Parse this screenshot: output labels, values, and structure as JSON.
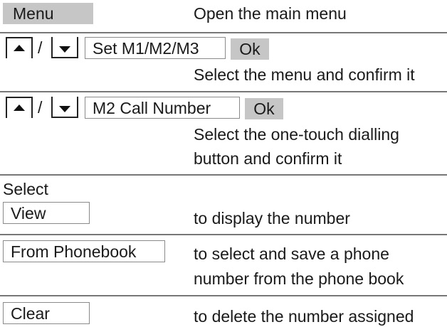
{
  "rows": [
    {
      "key": "Menu",
      "description": "Open the main menu"
    },
    {
      "slash": "/",
      "box": "Set M1/M2/M3",
      "ok": "Ok",
      "description": "Select the menu and confirm it"
    },
    {
      "slash": "/",
      "box": "M2 Call Number",
      "ok": "Ok",
      "description_line1": "Select the one-touch dialling",
      "description_line2": "button and confirm it"
    }
  ],
  "select_heading": "Select",
  "options": [
    {
      "key": "View",
      "description": "to display the number"
    },
    {
      "key": "From Phonebook",
      "description_line1": "to select and save a phone",
      "description_line2": "number from the phone book"
    },
    {
      "key": "Clear",
      "description": "to delete the number assigned"
    }
  ],
  "icons": {
    "up": "up-arrow-key-icon",
    "down": "down-arrow-key-icon"
  }
}
